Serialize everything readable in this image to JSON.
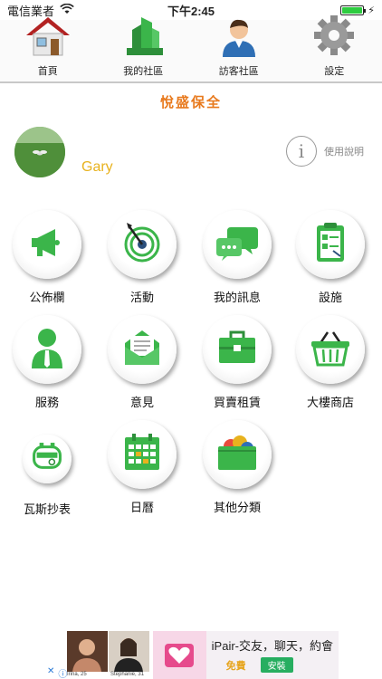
{
  "status_bar": {
    "carrier": "電信業者",
    "time": "下午2:45",
    "battery_level": 1.0
  },
  "tabs": [
    {
      "label": "首頁",
      "icon": "house-icon"
    },
    {
      "label": "我的社區",
      "icon": "buildings-icon"
    },
    {
      "label": "訪客社區",
      "icon": "person-icon"
    },
    {
      "label": "設定",
      "icon": "gear-icon"
    }
  ],
  "community_title": "悅盛保全",
  "profile": {
    "name": "Gary"
  },
  "help": {
    "label": "使用說明"
  },
  "grid": [
    {
      "label": "公佈欄",
      "icon": "megaphone-icon"
    },
    {
      "label": "活動",
      "icon": "target-icon"
    },
    {
      "label": "我的訊息",
      "icon": "chat-bubble-icon"
    },
    {
      "label": "設施",
      "icon": "clipboard-icon"
    },
    {
      "label": "服務",
      "icon": "person-tie-icon"
    },
    {
      "label": "意見",
      "icon": "envelope-icon"
    },
    {
      "label": "買賣租賃",
      "icon": "briefcase-icon"
    },
    {
      "label": "大樓商店",
      "icon": "basket-icon"
    },
    {
      "label": "瓦斯抄表",
      "icon": "gas-meter-icon"
    },
    {
      "label": "日曆",
      "icon": "calendar-icon"
    },
    {
      "label": "其他分類",
      "icon": "folder-icon"
    }
  ],
  "ad": {
    "title": "iPair-交友，聊天，約會",
    "free": "免費",
    "install": "安裝",
    "photo_captions": [
      "Irina, 25",
      "Stephanie, 31"
    ]
  },
  "colors": {
    "accent_green": "#3bb54a",
    "title_orange": "#e87a1e",
    "name_yellow": "#e8b21e"
  }
}
